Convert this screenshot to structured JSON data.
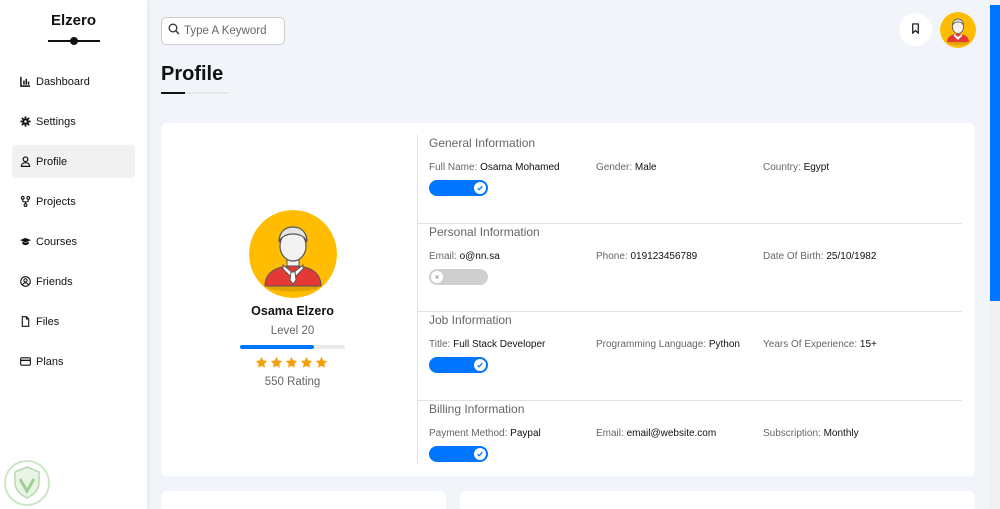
{
  "sidebar": {
    "brand": "Elzero",
    "items": [
      {
        "label": "Dashboard",
        "icon": "chart-icon"
      },
      {
        "label": "Settings",
        "icon": "gear-icon"
      },
      {
        "label": "Profile",
        "icon": "user-icon",
        "active": true
      },
      {
        "label": "Projects",
        "icon": "branch-icon"
      },
      {
        "label": "Courses",
        "icon": "graduation-cap-icon"
      },
      {
        "label": "Friends",
        "icon": "user-circle-icon"
      },
      {
        "label": "Files",
        "icon": "file-icon"
      },
      {
        "label": "Plans",
        "icon": "credit-card-icon"
      }
    ]
  },
  "header": {
    "search_placeholder": "Type A Keyword"
  },
  "page": {
    "title": "Profile"
  },
  "profile": {
    "name": "Osama Elzero",
    "level": "Level 20",
    "level_progress": 0.7,
    "stars": 5,
    "rating": "550 Rating"
  },
  "sections": [
    {
      "title": "General Information",
      "fields": [
        {
          "label": "Full Name:",
          "value": "Osama Mohamed"
        },
        {
          "label": "Gender:",
          "value": "Male"
        },
        {
          "label": "Country:",
          "value": "Egypt"
        }
      ],
      "toggle_on": true
    },
    {
      "title": "Personal Information",
      "fields": [
        {
          "label": "Email:",
          "value": "o@nn.sa"
        },
        {
          "label": "Phone:",
          "value": "019123456789"
        },
        {
          "label": "Date Of Birth:",
          "value": "25/10/1982"
        }
      ],
      "toggle_on": false
    },
    {
      "title": "Job Information",
      "fields": [
        {
          "label": "Title:",
          "value": "Full Stack Developer"
        },
        {
          "label": "Programming Language:",
          "value": "Python"
        },
        {
          "label": "Years Of Experience:",
          "value": "15+"
        }
      ],
      "toggle_on": true
    },
    {
      "title": "Billing Information",
      "fields": [
        {
          "label": "Payment Method:",
          "value": "Paypal"
        },
        {
          "label": "Email:",
          "value": "email@website.com"
        },
        {
          "label": "Subscription:",
          "value": "Monthly"
        }
      ],
      "toggle_on": true
    }
  ],
  "colors": {
    "accent": "#0075ff",
    "star": "#f59e0b",
    "avatar_bg": "#ffbc00"
  }
}
